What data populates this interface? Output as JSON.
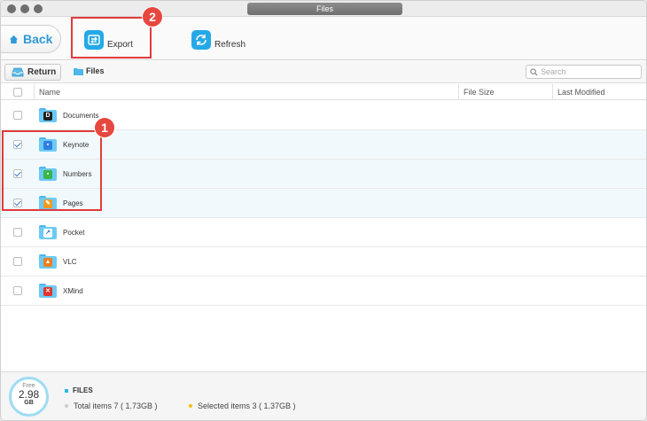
{
  "window": {
    "title": "Files"
  },
  "toolbar": {
    "back_label": "Back",
    "export_label": "Export",
    "refresh_label": "Refresh"
  },
  "annotations": {
    "badge1": "1",
    "badge2": "2"
  },
  "nav": {
    "return_label": "Return",
    "breadcrumb": "Files",
    "search_placeholder": "Search"
  },
  "table": {
    "columns": {
      "name": "Name",
      "size": "File Size",
      "modified": "Last Modified"
    },
    "rows": [
      {
        "name": "Documents",
        "checked": false,
        "app_icon": "documents-app-icon",
        "app_color": "#1f1f1f",
        "glyph": "D"
      },
      {
        "name": "Keynote",
        "checked": true,
        "app_icon": "keynote-app-icon",
        "app_color": "#2f7fe0",
        "glyph": "▪"
      },
      {
        "name": "Numbers",
        "checked": true,
        "app_icon": "numbers-app-icon",
        "app_color": "#39b54a",
        "glyph": "▪"
      },
      {
        "name": "Pages",
        "checked": true,
        "app_icon": "pages-app-icon",
        "app_color": "#f39a1e",
        "glyph": "✎"
      },
      {
        "name": "Pocket",
        "checked": false,
        "app_icon": "pocket-app-icon",
        "app_color": "#ffffff",
        "glyph": "↗"
      },
      {
        "name": "VLC",
        "checked": false,
        "app_icon": "vlc-app-icon",
        "app_color": "#f07e1b",
        "glyph": "▲"
      },
      {
        "name": "XMind",
        "checked": false,
        "app_icon": "xmind-app-icon",
        "app_color": "#e2332c",
        "glyph": "✕"
      }
    ]
  },
  "footer": {
    "free_label": "Free",
    "free_value": "2.98",
    "free_unit": "GB",
    "section_label": "FILES",
    "total_items": "Total items 7 ( 1.73GB )",
    "selected_items": "Selected items 3 ( 1.37GB )"
  },
  "colors": {
    "accent": "#25a9e6",
    "annotation_red": "#e03c3c",
    "selected_row": "#f2f9fc",
    "selected_dot": "#f2c200",
    "total_dot": "#cccccc"
  }
}
